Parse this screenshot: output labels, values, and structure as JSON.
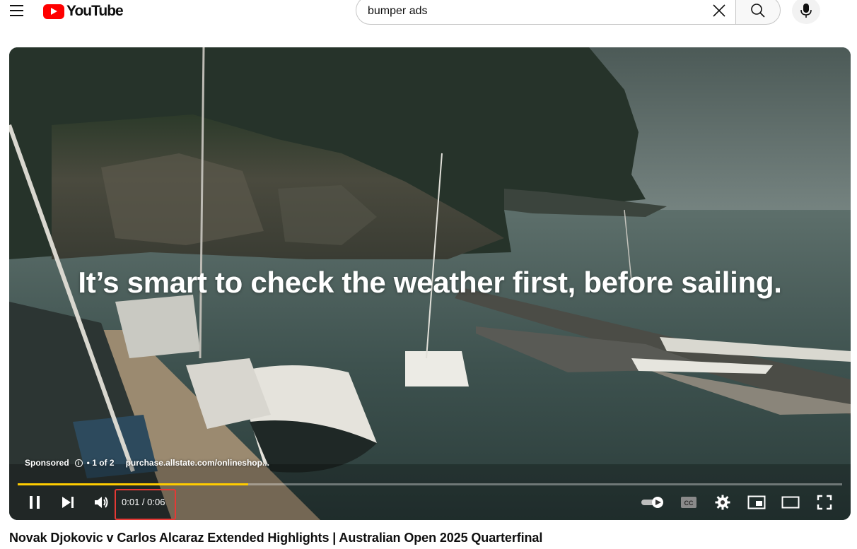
{
  "masthead": {
    "logo_text": "YouTube",
    "search": {
      "value": "bumper ads",
      "placeholder": "Search"
    }
  },
  "player": {
    "caption": "It’s smart to check the weather first, before sailing.",
    "ad": {
      "sponsored_label": "Sponsored",
      "position_label": "• 1 of 2",
      "url": "purchase.allstate.com/onlineshop..."
    },
    "progress": {
      "played_fraction": 0.28,
      "accent_color": "#ffcc00"
    },
    "time": {
      "display": "0:01 / 0:06",
      "current": "0:01",
      "duration": "0:06"
    },
    "controls": {
      "icons": [
        "pause-icon",
        "next-icon",
        "volume-icon",
        "autoplay-toggle-icon",
        "captions-icon",
        "settings-icon",
        "miniplayer-icon",
        "theater-mode-icon",
        "fullscreen-icon"
      ]
    }
  },
  "video": {
    "title": "Novak Djokovic v Carlos Alcaraz Extended Highlights | Australian Open 2025 Quarterfinal"
  },
  "colors": {
    "brand_red": "#ff0000",
    "highlight_box": "#e53935"
  }
}
